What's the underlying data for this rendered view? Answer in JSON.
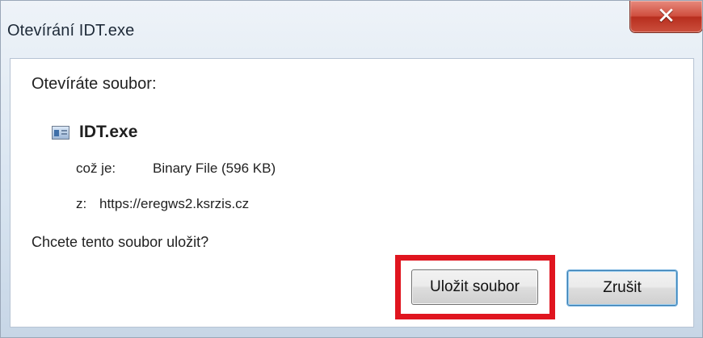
{
  "window": {
    "title": "Otevírání IDT.exe",
    "close_icon": "close-icon",
    "accent_color": "#e0151f"
  },
  "dialog": {
    "opening_label": "Otevíráte soubor:",
    "file_icon": "file-icon",
    "filename": "IDT.exe",
    "type_label": "což je:",
    "type_value": "Binary File (596 KB)",
    "from_label": "z:",
    "from_value": "https://eregws2.ksrzis.cz",
    "question": "Chcete tento soubor uložit?"
  },
  "buttons": {
    "save": "Uložit soubor",
    "cancel": "Zrušit"
  }
}
